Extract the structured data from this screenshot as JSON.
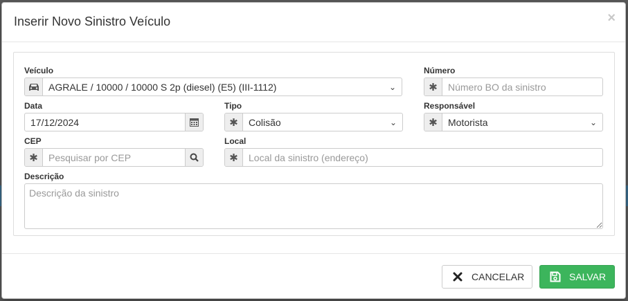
{
  "modal": {
    "title": "Inserir Novo Sinistro Veículo",
    "close_label": "×"
  },
  "fields": {
    "veiculo": {
      "label": "Veículo",
      "value": "AGRALE / 10000 / 10000 S 2p (diesel) (E5) (III-1112)"
    },
    "numero": {
      "label": "Número",
      "placeholder": "Número BO da sinistro"
    },
    "data": {
      "label": "Data",
      "value": "17/12/2024"
    },
    "tipo": {
      "label": "Tipo",
      "value": "Colisão"
    },
    "responsavel": {
      "label": "Responsável",
      "value": "Motorista"
    },
    "cep": {
      "label": "CEP",
      "placeholder": "Pesquisar por CEP"
    },
    "local": {
      "label": "Local",
      "placeholder": "Local da sinistro (endereço)"
    },
    "descricao": {
      "label": "Descrição",
      "placeholder": "Descrição da sinistro"
    }
  },
  "footer": {
    "cancel_label": "CANCELAR",
    "save_label": "SALVAR"
  },
  "icons": {
    "car": "car-icon",
    "asterisk": "asterisk-icon",
    "calendar": "calendar-icon",
    "search": "search-icon",
    "close": "x-icon",
    "save": "floppy-icon"
  },
  "colors": {
    "save_button": "#3cb55c",
    "addon_bg": "#eeeeee"
  }
}
